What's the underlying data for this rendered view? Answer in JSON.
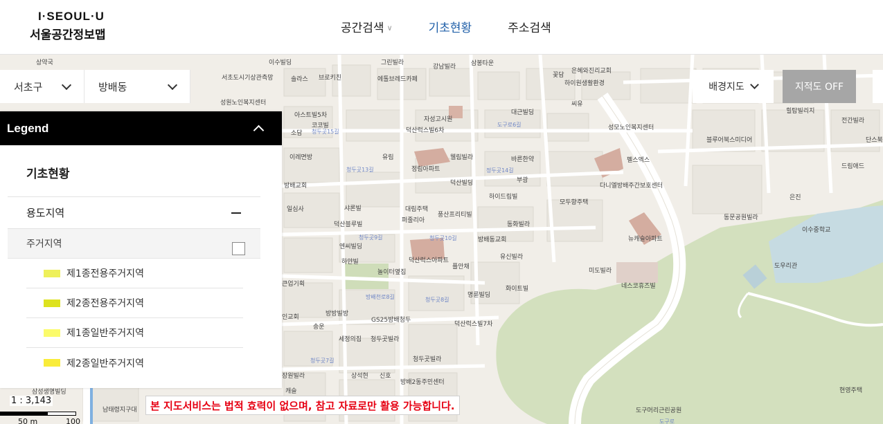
{
  "header": {
    "logo_top": "I·SEOUL·U",
    "logo_bottom": "서울공간정보맵",
    "nav": [
      {
        "label": "공간검색",
        "has_dropdown": true,
        "active": false
      },
      {
        "label": "기초현황",
        "has_dropdown": false,
        "active": true
      },
      {
        "label": "주소검색",
        "has_dropdown": false,
        "active": false
      }
    ]
  },
  "region": {
    "gu": "서초구",
    "dong": "방배동"
  },
  "map_controls": {
    "basemap_label": "배경지도",
    "cadastral_label": "지적도 OFF"
  },
  "legend": {
    "title": "Legend",
    "section_title": "기초현황",
    "group_title": "용도지역",
    "subgroup_title": "주거지역",
    "subgroup_checked": false,
    "items": [
      {
        "label": "제1종전용주거지역",
        "color": "#eef05a"
      },
      {
        "label": "제2종전용주거지역",
        "color": "#dde21f"
      },
      {
        "label": "제1종일반주거지역",
        "color": "#fbfb6b"
      },
      {
        "label": "제2종일반주거지역",
        "color": "#f9ec3a"
      }
    ]
  },
  "scale": {
    "ratio": "1 : 3,143",
    "label_50": "50 m",
    "label_100": "100 m"
  },
  "disclaimer": "본 지도서비스는 법적 효력이 없으며, 참고 자료로만 활용 가능합니다.",
  "map_labels": {
    "places": [
      "상약국",
      "이수빌딩",
      "그린빌라",
      "강남빌라",
      "삼봉타운",
      "꽃담",
      "은혜와진리교회",
      "솔라스",
      "브로키친",
      "에톨브레드카페",
      "하이원생활환경",
      "씨유",
      "서초도시기상관측망",
      "성원노인복지센터",
      "아스트빌5차",
      "코코빌",
      "자성고시원",
      "대근빌딩",
      "성모노인복지센터",
      "힐탑빌리지",
      "전간빌라",
      "소담",
      "덕산럭스빌6차",
      "블루어북스미디어",
      "이레면방",
      "유림",
      "웰림빌라",
      "바른한약",
      "펠스엑스",
      "단스북",
      "정림아파트",
      "방배교회",
      "덕산빌딩",
      "부광",
      "다니엘방배주간보호센터",
      "드림애드",
      "은진",
      "하이드림빌",
      "모두향주택",
      "동문공원빌라",
      "일심사",
      "샤론빌",
      "대림주택",
      "풍산프리티빌",
      "동화빌라",
      "덕산블루빌",
      "퍼줄리아",
      "뉴캐슬아파트",
      "이수중학교",
      "방배동교회",
      "엔씨빌딩",
      "유신빌라",
      "도우리관",
      "하얀빌",
      "놀이터옆집",
      "덕산럭스아파트",
      "플안채",
      "미도빌라",
      "큰업기획",
      "네스코휴즈빌",
      "화이트빌",
      "명륜빌딩",
      "인교회",
      "방방빌방",
      "GS25방배청두",
      "덕산럭스빌7차",
      "송운",
      "세정의집",
      "청두곳빌라",
      "청두곳빌라",
      "상석현",
      "신호",
      "방배2동주민센터",
      "장원빌라",
      "캐슬",
      "도구머리근린공원",
      "현영주택",
      "남태령지구대",
      "삼성생명빌딩"
    ],
    "streets": [
      "청두곳15길",
      "청두곳13길",
      "정두곳14길",
      "도구로6길",
      "청두곳9길",
      "청두곳10길",
      "청두곳8길",
      "청두곳7길",
      "방배천로8길",
      "도구로"
    ]
  }
}
